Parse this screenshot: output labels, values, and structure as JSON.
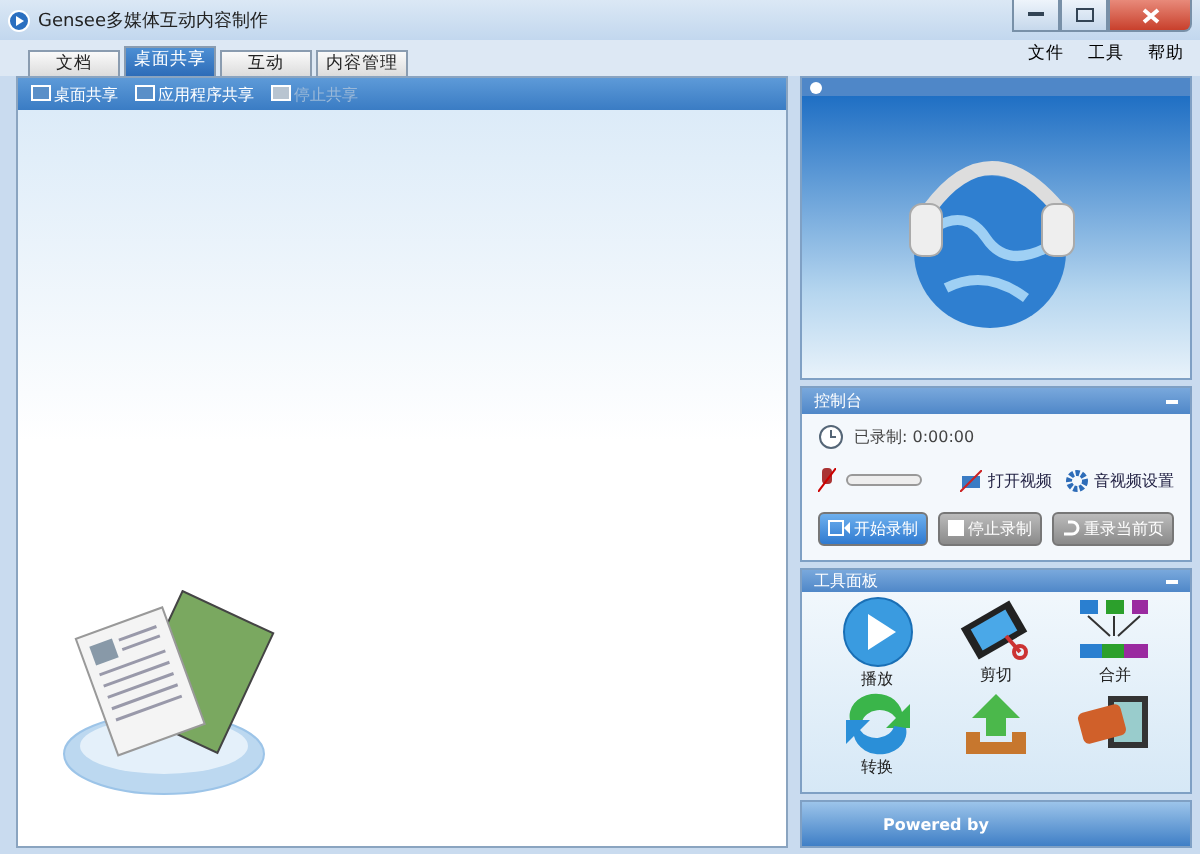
{
  "window": {
    "title": "Gensee多媒体互动内容制作"
  },
  "tabs": [
    {
      "label": "文档",
      "selected": false
    },
    {
      "label": "桌面共享",
      "selected": true
    },
    {
      "label": "互动",
      "selected": false
    },
    {
      "label": "内容管理",
      "selected": false
    }
  ],
  "menu": [
    "文件",
    "工具",
    "帮助"
  ],
  "toolbar": [
    {
      "label": "桌面共享",
      "disabled": false
    },
    {
      "label": "应用程序共享",
      "disabled": false
    },
    {
      "label": "停止共享",
      "disabled": true
    }
  ],
  "control_panel": {
    "title": "控制台",
    "recorded": "已录制: 0:00:00",
    "mic": {
      "muted": true,
      "level": 0
    },
    "open_video": "打开视频",
    "av_settings": "音视频设置",
    "buttons": [
      {
        "label": "开始录制",
        "kind": "primary"
      },
      {
        "label": "停止录制",
        "kind": "stop"
      },
      {
        "label": "重录当前页",
        "kind": "redo"
      }
    ]
  },
  "tool_panel": {
    "title": "工具面板",
    "tools": [
      {
        "kind": "play",
        "label": "播放"
      },
      {
        "kind": "cut",
        "label": "剪切"
      },
      {
        "kind": "merge",
        "label": "合并"
      },
      {
        "kind": "convert",
        "label": "转换"
      },
      {
        "kind": "upload"
      },
      {
        "kind": "pdf"
      }
    ]
  },
  "footer": {
    "text": "Powered by"
  }
}
